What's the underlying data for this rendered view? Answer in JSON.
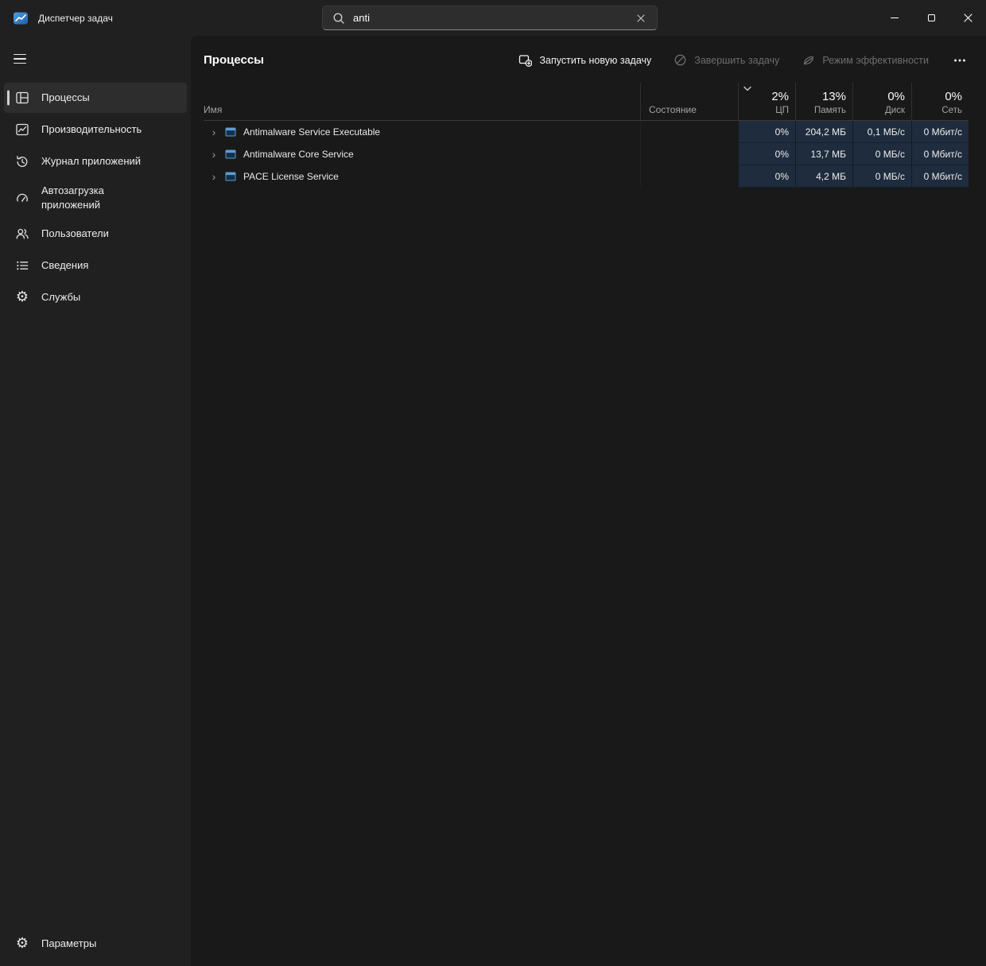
{
  "titlebar": {
    "app_title": "Диспетчер задач",
    "search": {
      "value": "anti"
    }
  },
  "sidebar": {
    "items": [
      {
        "label": "Процессы",
        "icon": "processes-icon",
        "selected": true
      },
      {
        "label": "Производительность",
        "icon": "performance-icon",
        "selected": false
      },
      {
        "label": "Журнал приложений",
        "icon": "app-history-icon",
        "selected": false
      },
      {
        "label": "Автозагрузка приложений",
        "icon": "startup-icon",
        "selected": false
      },
      {
        "label": "Пользователи",
        "icon": "users-icon",
        "selected": false
      },
      {
        "label": "Сведения",
        "icon": "details-icon",
        "selected": false
      },
      {
        "label": "Службы",
        "icon": "services-icon",
        "selected": false
      }
    ],
    "settings_label": "Параметры"
  },
  "main": {
    "title": "Процессы",
    "toolbar": {
      "run_new_task": "Запустить новую задачу",
      "end_task": "Завершить задачу",
      "efficiency_mode": "Режим эффективности"
    },
    "table": {
      "columns": {
        "name": "Имя",
        "status": "Состояние",
        "cpu": {
          "label": "ЦП",
          "total": "2%"
        },
        "memory": {
          "label": "Память",
          "total": "13%"
        },
        "disk": {
          "label": "Диск",
          "total": "0%"
        },
        "network": {
          "label": "Сеть",
          "total": "0%"
        }
      },
      "rows": [
        {
          "name": "Antimalware Service Executable",
          "status": "",
          "cpu": "0%",
          "memory": "204,2 МБ",
          "disk": "0,1 МБ/с",
          "network": "0 Мбит/с"
        },
        {
          "name": "Antimalware Core Service",
          "status": "",
          "cpu": "0%",
          "memory": "13,7 МБ",
          "disk": "0 МБ/с",
          "network": "0 Мбит/с"
        },
        {
          "name": "PACE License Service",
          "status": "",
          "cpu": "0%",
          "memory": "4,2 МБ",
          "disk": "0 МБ/с",
          "network": "0 Мбит/с"
        }
      ]
    }
  },
  "colors": {
    "accent": "#cfcfcf",
    "heatmap_cell": "#1e2c3d"
  }
}
